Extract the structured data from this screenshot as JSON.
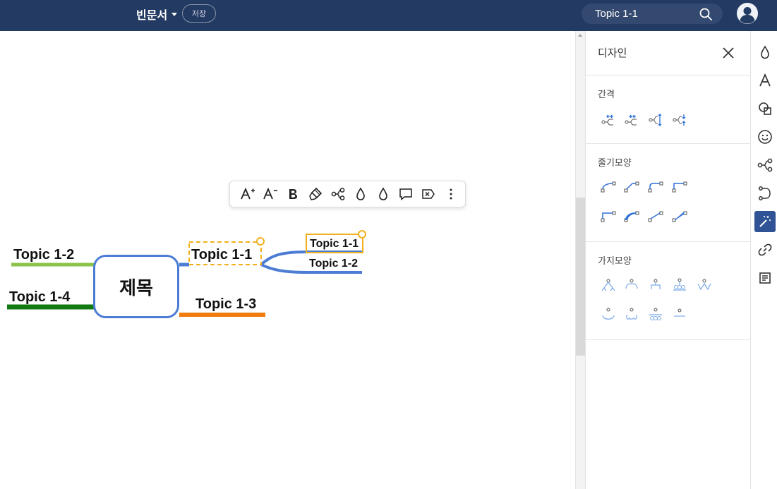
{
  "header": {
    "doc_title": "빈문서",
    "save_label": "저장",
    "search_value": "Topic 1-1",
    "search_placeholder": "",
    "bg_color": "#233a62"
  },
  "canvas": {
    "root": {
      "label": "제목"
    },
    "nodes": {
      "t12_left": "Topic 1-2",
      "t14_left": "Topic 1-4",
      "t11_main": "Topic 1-1",
      "t13_right": "Topic 1-3",
      "t11_sub": "Topic 1-1",
      "t12_sub": "Topic 1-2"
    },
    "colors": {
      "root_border": "#4c7cd4",
      "branch_blue": "#4c7cd4",
      "branch_light_green": "#8bc34a",
      "branch_dark_green": "#127a12",
      "branch_orange": "#f07c10",
      "selection": "#f2b01e"
    },
    "float_toolbar": [
      {
        "label": "A+",
        "icon": "font-size-increase-icon"
      },
      {
        "label": "A−",
        "icon": "font-size-decrease-icon"
      },
      {
        "label": "B",
        "icon": "bold-icon"
      },
      {
        "label": "",
        "icon": "format-paint-icon"
      },
      {
        "label": "",
        "icon": "branch-icon"
      },
      {
        "label": "",
        "icon": "fill-color-icon"
      },
      {
        "label": "",
        "icon": "line-color-icon"
      },
      {
        "label": "",
        "icon": "comment-icon"
      },
      {
        "label": "",
        "icon": "clear-format-icon"
      },
      {
        "label": "",
        "icon": "more-vertical-icon"
      }
    ]
  },
  "panel": {
    "title": "디자인",
    "sections": {
      "spacing": {
        "label": "간격"
      },
      "stem_shape": {
        "label": "줄기모양"
      },
      "branch_shape": {
        "label": "가지모양"
      }
    }
  },
  "strip": [
    "fill-drop-icon",
    "text-icon",
    "shapes-icon",
    "emoji-icon",
    "structure-icon",
    "relation-icon",
    "magic-wand-icon",
    "link-icon",
    "note-icon"
  ]
}
